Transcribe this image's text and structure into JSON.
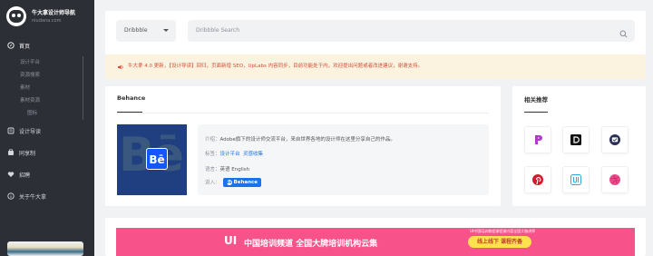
{
  "logo": {
    "title": "牛大拿设计师导航",
    "subtitle": "niudana.com"
  },
  "nav": {
    "home": "首页",
    "home_sub": [
      "设计平台",
      "资源搜索",
      "素材",
      "素材资源"
    ],
    "home_child": "图标",
    "items": [
      "设计导读",
      "同享制",
      "招聘",
      "关于牛大拿"
    ]
  },
  "search": {
    "select": "Dribbble",
    "placeholder": "Dribbble Search"
  },
  "notice": {
    "text": "牛大拿 4.0 更新，【设计导读】回归，页面新增 SEO，UpLabs 内容同步，目前功能处于内，欢迎提出问题或者改进建议，谢谢支持。"
  },
  "main": {
    "title": "Behance",
    "row1_label": "介绍：",
    "row1_value": "Adobe旗下的设计师交流平台，来自世界各地的设计师在这里分享自己的作品。",
    "row2_label": "标签：",
    "row2_tags": [
      "设计平台",
      "灵感收集"
    ],
    "row3_label": "语言：",
    "row3_value": "英语 English",
    "row4_label": "进入：",
    "button": "Behance",
    "button_icon": "Bē"
  },
  "side": {
    "title": "相关推荐"
  },
  "banner": {
    "small": "UI中国培训教程课程课内容全国大咖讲师",
    "ui": "UI",
    "text": "中国培训频道  全国大牌培训机构云集",
    "tag": "线上线下 课程齐备"
  },
  "colors": {
    "accent": "#1a73e8",
    "sidebar": "#2c2f36",
    "banner": "#f7538a"
  }
}
